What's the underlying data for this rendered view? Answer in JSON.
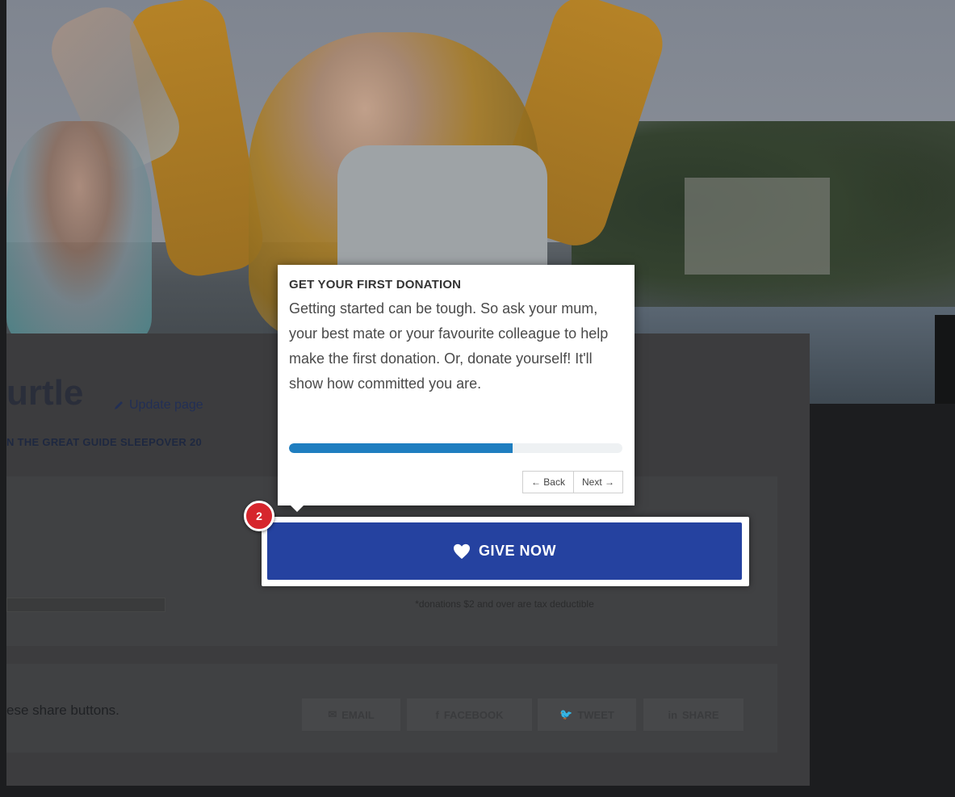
{
  "page": {
    "title_fragment": "urtle",
    "update_link": "Update page",
    "event_line": "N THE GREAT GUIDE SLEEPOVER 20",
    "tax_note": "*donations $2 and over are tax deductible",
    "share_text": "ese share buttons.",
    "share_buttons": [
      "EMAIL",
      "FACEBOOK",
      "TWEET",
      "SHARE"
    ]
  },
  "give_button": {
    "label": "GIVE NOW"
  },
  "tour": {
    "step_number": "2",
    "title": "GET YOUR FIRST DONATION",
    "body": "Getting started can be tough. So ask your mum, your best mate or your favourite colleague to help make the first donation. Or, donate yourself! It'll show how committed you are.",
    "progress_percent": 67,
    "back_label": "← Back",
    "next_label": "Next →"
  },
  "colors": {
    "give_button": "#2542a0",
    "progress_fill": "#1f7ec0",
    "step_badge": "#d6262d"
  }
}
